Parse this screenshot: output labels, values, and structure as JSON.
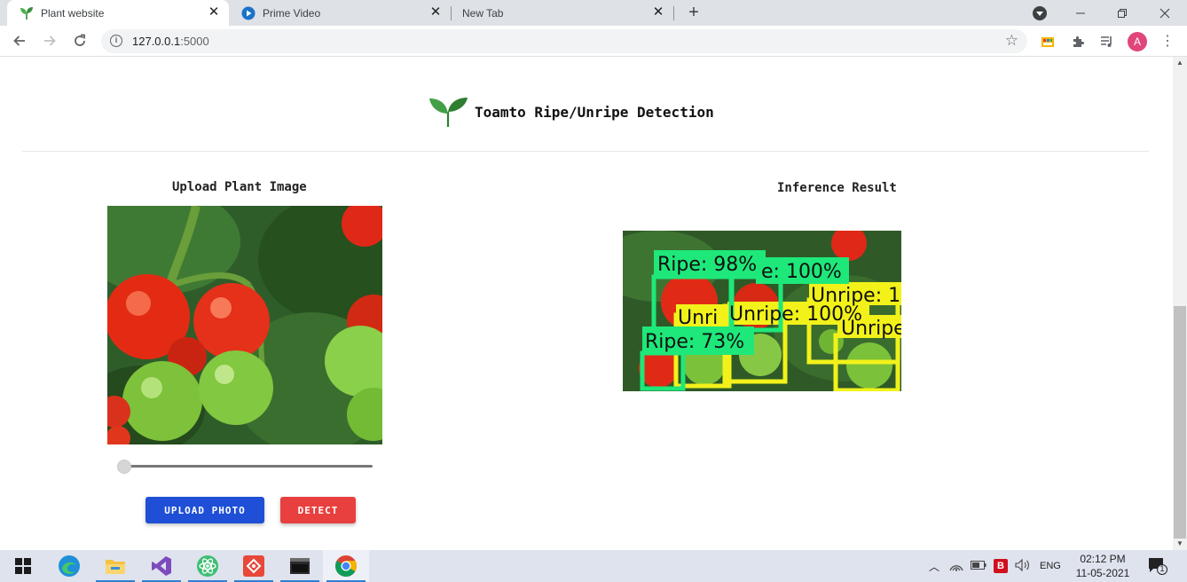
{
  "browser": {
    "tabs": [
      {
        "title": "Plant website",
        "active": true,
        "favicon": "sprout-icon"
      },
      {
        "title": "Prime Video",
        "active": false,
        "favicon": "prime-video-icon"
      },
      {
        "title": "New Tab",
        "active": false,
        "favicon": ""
      }
    ],
    "new_tab_symbol": "+",
    "url_host": "127.0.0.1",
    "url_port": ":5000",
    "profile_initial": "A"
  },
  "page": {
    "title": "Toamto Ripe/Unripe Detection",
    "upload_heading": "Upload Plant Image",
    "result_heading": "Inference Result",
    "upload_button": "UPLOAD PHOTO",
    "detect_button": "DETECT",
    "slider_value": 0,
    "detections": [
      {
        "label": "Ripe: 98%",
        "color": "#1ee87a"
      },
      {
        "label": "e: 100%",
        "color": "#1ee87a"
      },
      {
        "label": "Unripe: 1",
        "color": "#f2f21a"
      },
      {
        "label": "Unri",
        "color": "#f2f21a"
      },
      {
        "label": "Unripe: 100%",
        "color": "#f2f21a"
      },
      {
        "label": "Unripe",
        "color": "#f2f21a"
      },
      {
        "label": "Ripe: 73%",
        "color": "#1ee87a"
      }
    ]
  },
  "taskbar": {
    "apps": [
      "start-icon",
      "edge-icon",
      "file-explorer-icon",
      "visual-studio-icon",
      "atom-icon",
      "git-icon",
      "terminal-icon",
      "chrome-icon"
    ],
    "language": "ENG",
    "time": "02:12 PM",
    "date": "11-05-2021",
    "notifications": "1"
  },
  "colors": {
    "upload_button": "#1e4fd6",
    "detect_button": "#e8403e",
    "ripe_box": "#1ee87a",
    "unripe_box": "#f2f21a"
  }
}
